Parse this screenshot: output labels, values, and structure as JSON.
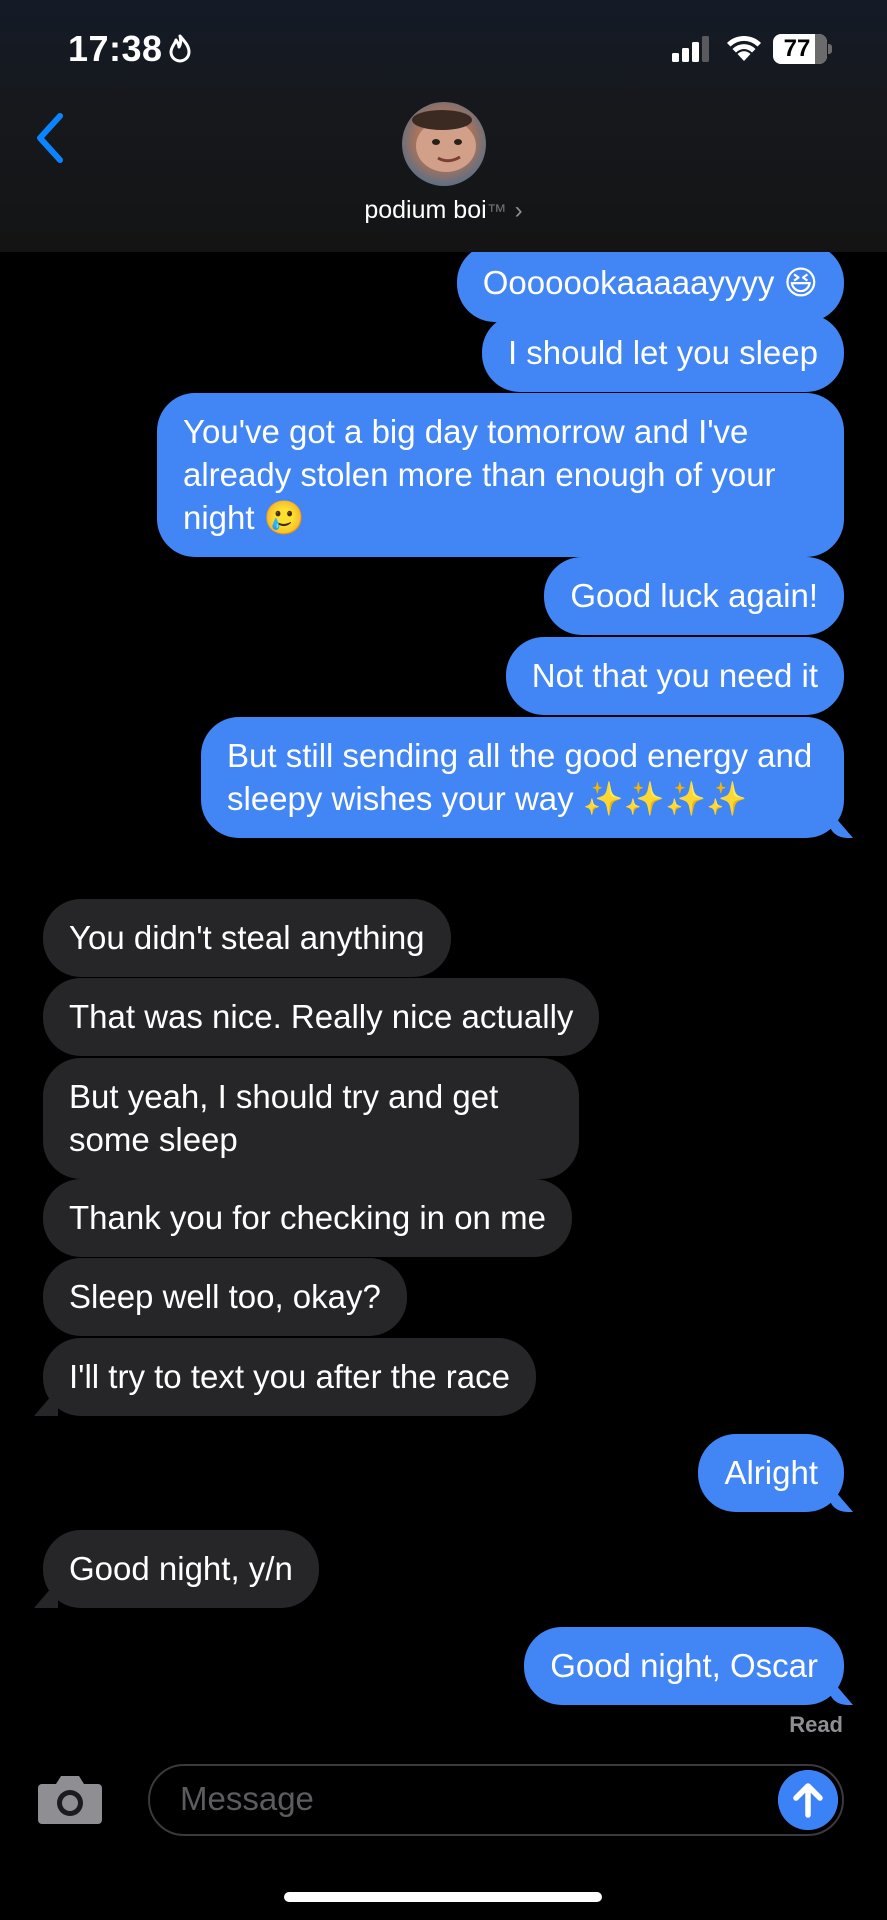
{
  "status_bar": {
    "time": "17:38",
    "battery": "77",
    "battery_level": 0.77
  },
  "header": {
    "contact_name": "podium boi",
    "trademark": "™",
    "chevron": "›"
  },
  "messages": [
    {
      "from": "me",
      "text": "Ooooookaaaaayyyy 😆"
    },
    {
      "from": "me",
      "text": "I should let you sleep"
    },
    {
      "from": "me",
      "text": "You've got a big day tomorrow and I've already stolen more than enough of your night 🥲"
    },
    {
      "from": "me",
      "text": "Good luck again!"
    },
    {
      "from": "me",
      "text": "Not that you need it"
    },
    {
      "from": "me",
      "text": "But still sending all the good energy and sleepy wishes your way ✨✨✨✨"
    },
    {
      "from": "them",
      "text": "You didn't steal anything"
    },
    {
      "from": "them",
      "text": "That was nice. Really nice actually"
    },
    {
      "from": "them",
      "text": "But yeah, I should try and get some sleep"
    },
    {
      "from": "them",
      "text": "Thank you for checking in on me"
    },
    {
      "from": "them",
      "text": "Sleep well too, okay?"
    },
    {
      "from": "them",
      "text": "I'll try to text you after the race"
    },
    {
      "from": "me",
      "text": "Alright"
    },
    {
      "from": "them",
      "text": "Good night, y/n"
    },
    {
      "from": "me",
      "text": "Good night, Oscar"
    }
  ],
  "read_receipt": "Read",
  "composer": {
    "placeholder": "Message"
  },
  "colors": {
    "sent_bubble": "#4285f4",
    "received_bubble": "#262628",
    "accent": "#0a84ff"
  }
}
